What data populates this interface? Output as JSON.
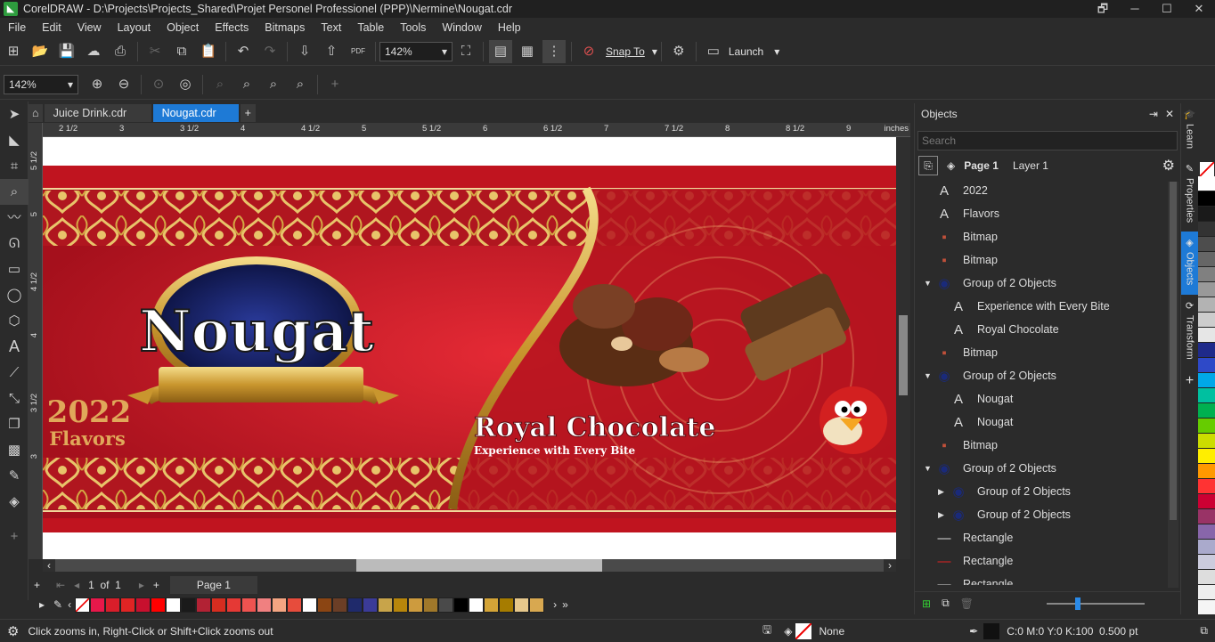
{
  "window": {
    "title": "CorelDRAW - D:\\Projects\\Projects_Shared\\Projet Personel Professionel (PPP)\\Nermine\\Nougat.cdr"
  },
  "menu": [
    "File",
    "Edit",
    "View",
    "Layout",
    "Object",
    "Effects",
    "Bitmaps",
    "Text",
    "Table",
    "Tools",
    "Window",
    "Help"
  ],
  "toolbar": {
    "zoom": "142%",
    "snap_label": "Snap To",
    "launch_label": "Launch",
    "pdf_label": "PDF"
  },
  "propbar": {
    "zoom": "142%"
  },
  "tabs": [
    "Juice Drink.cdr",
    "Nougat.cdr"
  ],
  "ruler": {
    "h_labels": [
      "2 1/2",
      "3",
      "3 1/2",
      "4",
      "4 1/2",
      "5",
      "5 1/2",
      "6",
      "6 1/2",
      "7",
      "7 1/2",
      "8",
      "8 1/2",
      "9"
    ],
    "unit": "inches",
    "v_labels": [
      "5 1/2",
      "5",
      "4 1/2",
      "4",
      "3 1/2",
      "3"
    ]
  },
  "design": {
    "brand": "Nougat",
    "year": "2022",
    "flavors": "Flavors",
    "headline": "Royal Chocolate",
    "tagline": "Experience with Every Bite"
  },
  "pagebar": {
    "counter": "1  of  1",
    "page_tab": "Page 1"
  },
  "objects": {
    "title": "Objects",
    "search_placeholder": "Search",
    "page": "Page 1",
    "layer": "Layer 1",
    "items": [
      {
        "icon": "text-icon",
        "label": "2022",
        "indent": 0
      },
      {
        "icon": "text-icon",
        "label": "Flavors",
        "indent": 0
      },
      {
        "icon": "bitmap-icon",
        "label": "Bitmap",
        "indent": 0
      },
      {
        "icon": "bitmap-icon",
        "label": "Bitmap",
        "indent": 0
      },
      {
        "icon": "group-icon",
        "label": "Group of 2 Objects",
        "indent": 0,
        "expanded": true
      },
      {
        "icon": "text-icon",
        "label": "Experience with Every Bite",
        "indent": 1
      },
      {
        "icon": "text-icon",
        "label": "Royal Chocolate",
        "indent": 1
      },
      {
        "icon": "bitmap-icon",
        "label": "Bitmap",
        "indent": 0
      },
      {
        "icon": "group-icon",
        "label": "Group of 2 Objects",
        "indent": 0,
        "expanded": true
      },
      {
        "icon": "text-icon",
        "label": "Nougat",
        "indent": 1
      },
      {
        "icon": "text-icon",
        "label": "Nougat",
        "indent": 1
      },
      {
        "icon": "bitmap-icon",
        "label": "Bitmap",
        "indent": 0
      },
      {
        "icon": "group-icon",
        "label": "Group of 2 Objects",
        "indent": 0,
        "expanded": true
      },
      {
        "icon": "group-icon",
        "label": "Group of 2 Objects",
        "indent": 1
      },
      {
        "icon": "group-icon",
        "label": "Group of 2 Objects",
        "indent": 1
      },
      {
        "icon": "rectangle-icon",
        "label": "Rectangle",
        "indent": 0
      },
      {
        "icon": "rectangle-red-icon",
        "label": "Rectangle",
        "indent": 0
      },
      {
        "icon": "rectangle-icon",
        "label": "Rectangle",
        "indent": 0
      }
    ]
  },
  "sidetabs": [
    "Learn",
    "Properties",
    "Objects",
    "Transform"
  ],
  "palette": [
    "#e8184a",
    "#d81e2a",
    "#e02424",
    "#c8102e",
    "#ff0000",
    "#ffffff",
    "#1a1a1a",
    "#b22234",
    "#d62d20",
    "#e53935",
    "#ef5350",
    "#f08080",
    "#f4a582",
    "#e74c3c",
    "#ffffff",
    "#8b4513",
    "#6b3e26",
    "#1f2a6b",
    "#3b3b98",
    "#c8a44a",
    "#b8860b",
    "#cd9b3e",
    "#a0782a",
    "#4a4a4a",
    "#000000",
    "#ffffff",
    "#d4a437",
    "#a67c00",
    "#e6c88c",
    "#d8a850"
  ],
  "colorstrip": [
    "#ffffff",
    "#000000",
    "#1a1a1a",
    "#333333",
    "#4d4d4d",
    "#666666",
    "#808080",
    "#999999",
    "#b3b3b3",
    "#cccccc",
    "#e6e6e6",
    "#1f2a8a",
    "#2e49c8",
    "#00a8e8",
    "#00c0a0",
    "#00b050",
    "#66cc00",
    "#ccdd00",
    "#ffee00",
    "#ff9900",
    "#ff3333",
    "#cc0033",
    "#993366",
    "#8866aa",
    "#aaaacc",
    "#ccccdd",
    "#dddddd",
    "#eeeeee",
    "#f5f5f5"
  ],
  "status": {
    "hint": "Click zooms in, Right-Click or Shift+Click zooms out",
    "fill": "None",
    "outline": "C:0 M:0 Y:0 K:100  0.500 pt"
  }
}
